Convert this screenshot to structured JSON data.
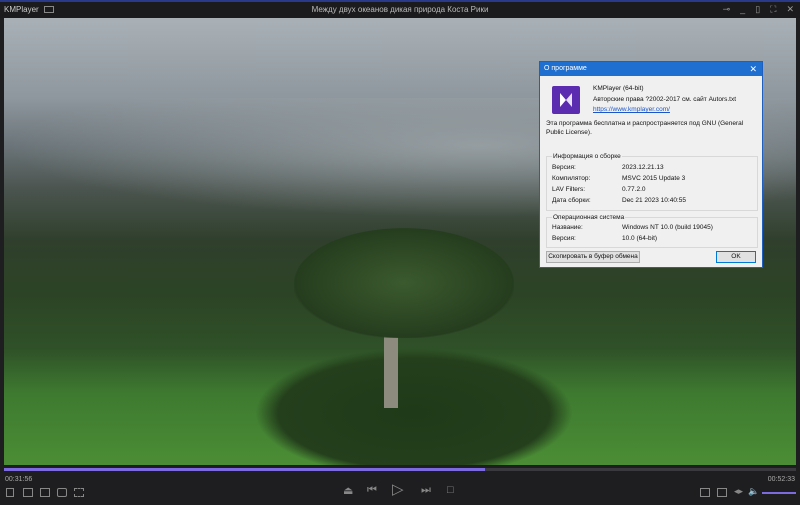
{
  "window": {
    "app_name": "KMPlayer",
    "title": "Между двух океанов дикая природа Коста Рики"
  },
  "dialog": {
    "title": "О программе",
    "product": "KMPlayer (64-bit)",
    "copyright": "Авторские права ?2002-2017 см. сайт Autors.txt",
    "url": "https://www.kmplayer.com/",
    "license": "Эта программа бесплатна и распространяется под GNU (General Public License).",
    "build_group": {
      "title": "Информация о сборке",
      "rows": [
        {
          "k": "Версия:",
          "v": "2023.12.21.13"
        },
        {
          "k": "Компилятор:",
          "v": "MSVC 2015 Update 3"
        },
        {
          "k": "LAV Filters:",
          "v": "0.77.2.0"
        },
        {
          "k": "Дата сборки:",
          "v": "Dec 21 2023 10:40:55"
        }
      ]
    },
    "os_group": {
      "title": "Операционная система",
      "rows": [
        {
          "k": "Название:",
          "v": "Windows NT 10.0 (build 19045)"
        },
        {
          "k": "Версия:",
          "v": "10.0 (64-bit)"
        }
      ]
    },
    "copy_button": "Скопировать в буфер обмена",
    "ok_button": "OK"
  },
  "player": {
    "elapsed": "00:31:56",
    "total": "00:52:33",
    "progress": 0.607,
    "volume": 1.0,
    "accent": "#7c6be0"
  }
}
